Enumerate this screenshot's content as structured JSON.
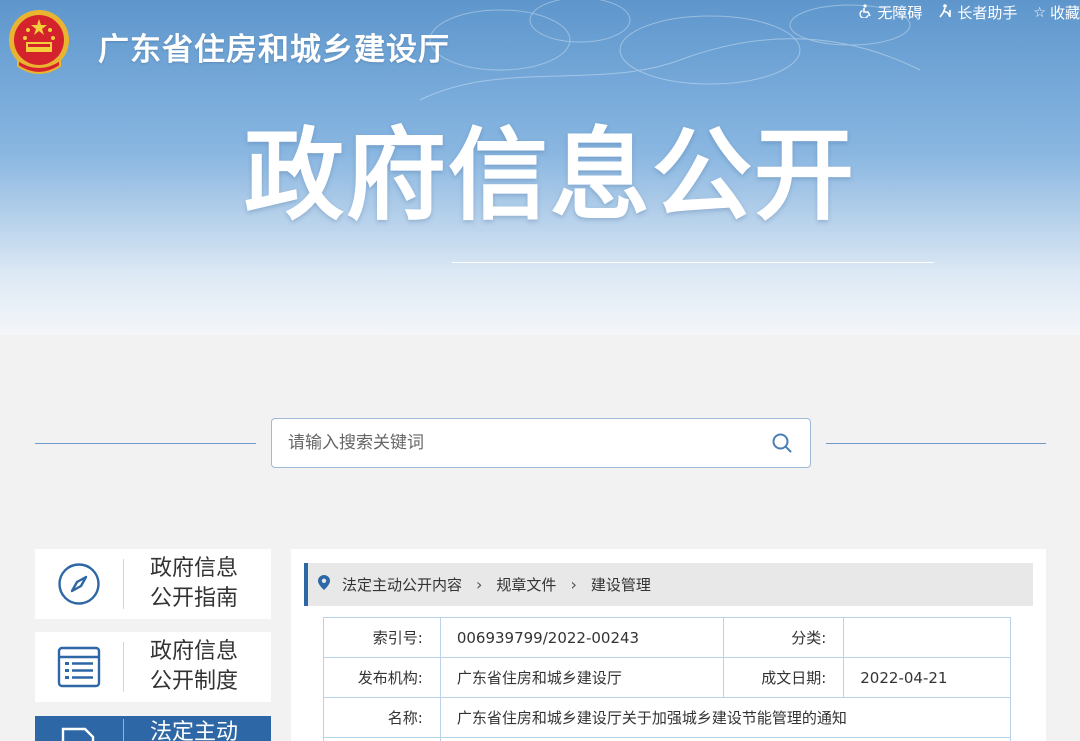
{
  "header": {
    "site_name": "广东省住房和城乡建设厅",
    "links": [
      {
        "label": "无障碍",
        "icon": "accessibility-icon"
      },
      {
        "label": "长者助手",
        "icon": "elder-helper-icon"
      },
      {
        "label": "收藏",
        "icon": "star-icon"
      }
    ],
    "banner_title": "政府信息公开"
  },
  "search": {
    "placeholder": "请输入搜索关键词",
    "icon": "search-icon"
  },
  "sidebar": {
    "items": [
      {
        "label_line1": "政府信息",
        "label_line2": "公开指南",
        "icon": "compass-icon"
      },
      {
        "label_line1": "政府信息",
        "label_line2": "公开制度",
        "icon": "list-document-icon"
      },
      {
        "label_line1": "法定主动",
        "label_line2": "",
        "icon": "folder-document-icon",
        "active": true
      }
    ]
  },
  "breadcrumb": {
    "icon": "location-pin-icon",
    "items": [
      "法定主动公开内容",
      "规章文件",
      "建设管理"
    ]
  },
  "document_meta": {
    "index_label": "索引号:",
    "index_value": "006939799/2022-00243",
    "category_label": "分类:",
    "category_value": "",
    "publisher_label": "发布机构:",
    "publisher_value": "广东省住房和城乡建设厅",
    "date_label": "成文日期:",
    "date_value": "2022-04-21",
    "name_label": "名称:",
    "name_value": "广东省住房和城乡建设厅关于加强城乡建设节能管理的通知"
  },
  "colors": {
    "accent": "#2e67a5",
    "banner_top": "#5e96cc",
    "table_border": "#b9d2ea"
  }
}
